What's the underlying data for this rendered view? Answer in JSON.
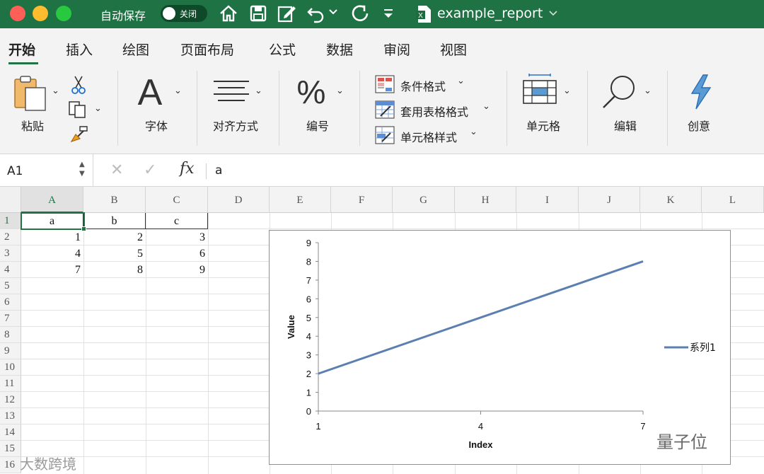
{
  "titlebar": {
    "autosave_label": "自动保存",
    "autosave_state": "关闭",
    "doc_title": "example_report",
    "bg_color": "#1f7244"
  },
  "tabs": [
    "开始",
    "插入",
    "绘图",
    "页面布局",
    "公式",
    "数据",
    "审阅",
    "视图"
  ],
  "active_tab": "开始",
  "ribbon": {
    "paste": "粘贴",
    "font": "字体",
    "align": "对齐方式",
    "number": "编号",
    "cond_format": "条件格式",
    "table_format": "套用表格格式",
    "cell_style": "单元格样式",
    "cells": "单元格",
    "editing": "编辑",
    "ideas": "创意"
  },
  "formula_bar": {
    "name_box": "A1",
    "formula": "a"
  },
  "columns": [
    "A",
    "B",
    "C",
    "D",
    "E",
    "F",
    "G",
    "H",
    "I",
    "J",
    "K",
    "L"
  ],
  "rows": [
    "1",
    "2",
    "3",
    "4",
    "5",
    "6",
    "7",
    "8",
    "9",
    "10",
    "11",
    "12",
    "13",
    "14",
    "15",
    "16"
  ],
  "sheet": {
    "headers": [
      "a",
      "b",
      "c"
    ],
    "values": [
      [
        "1",
        "2",
        "3"
      ],
      [
        "4",
        "5",
        "6"
      ],
      [
        "7",
        "8",
        "9"
      ]
    ]
  },
  "chart_data": {
    "type": "line",
    "x": [
      1,
      4,
      7
    ],
    "series": [
      {
        "name": "系列1",
        "values": [
          2,
          5,
          8
        ]
      }
    ],
    "xlabel": "Index",
    "ylabel": "Value",
    "xticks": [
      "1",
      "4",
      "7"
    ],
    "yticks": [
      "0",
      "1",
      "2",
      "3",
      "4",
      "5",
      "6",
      "7",
      "8",
      "9"
    ],
    "ylim": [
      0,
      9
    ],
    "xlim": [
      1,
      7
    ],
    "grid": false,
    "legend_position": "right",
    "line_color": "#5b7fb0"
  },
  "watermarks": {
    "bottom": "大数跨境",
    "right": "量子位"
  }
}
